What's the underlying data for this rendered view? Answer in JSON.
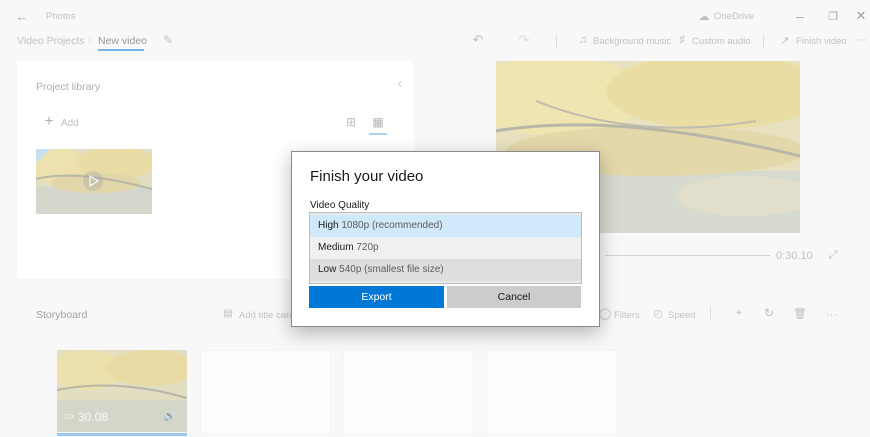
{
  "titlebar": {
    "app_name": "Photos",
    "onedrive_label": "OneDrive",
    "back_icon": "back-arrow-icon",
    "minimize_icon": "minimize-icon",
    "restore_icon": "restore-icon",
    "close_icon": "close-icon"
  },
  "toolbar": {
    "breadcrumb_root": "Video Projects",
    "breadcrumb_current": "New video",
    "background_music_label": "Background music",
    "custom_audio_label": "Custom audio",
    "finish_video_label": "Finish video",
    "more_label": "···"
  },
  "library": {
    "title": "Project library",
    "add_label": "Add"
  },
  "preview": {
    "time": "0:30.10"
  },
  "storyboard": {
    "title": "Storyboard",
    "add_title_card_label": "Add title card",
    "filters_label": "Filters",
    "speed_label": "Speed",
    "more_label": "···",
    "clip_duration": "30.08"
  },
  "dialog": {
    "title": "Finish your video",
    "quality_label": "Video Quality",
    "options": [
      {
        "main": "High",
        "sub": "1080p (recommended)"
      },
      {
        "main": "Medium",
        "sub": "720p"
      },
      {
        "main": "Low",
        "sub": "540p (smallest file size)"
      }
    ],
    "export_label": "Export",
    "cancel_label": "Cancel"
  },
  "colors": {
    "accent": "#0078d7",
    "highlight": "#cfe8fa"
  }
}
